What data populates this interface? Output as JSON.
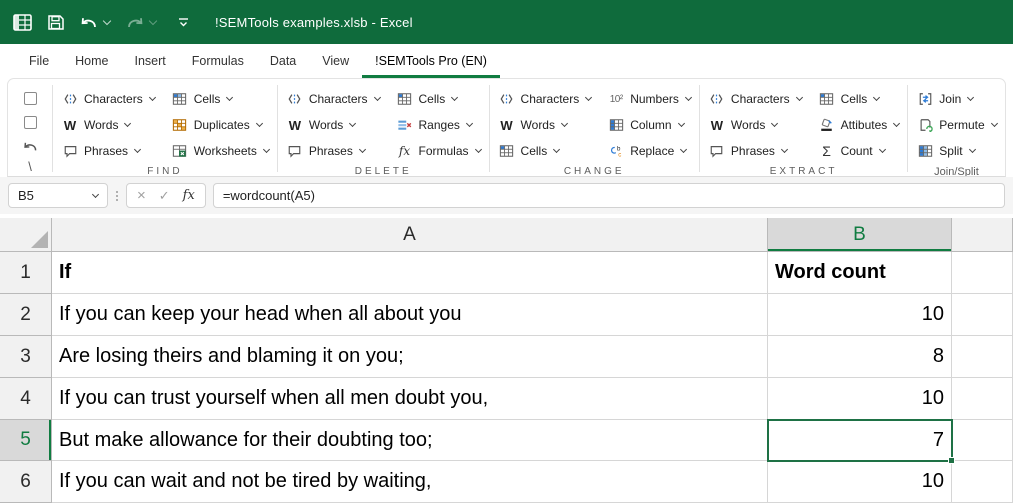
{
  "titlebar": {
    "title": "!SEMTools examples.xlsb  -  Excel",
    "icons": [
      "excel-logo-icon",
      "save-icon",
      "undo-icon",
      "redo-icon",
      "customize-quick-access-icon"
    ]
  },
  "tabs": {
    "items": [
      "File",
      "Home",
      "Insert",
      "Formulas",
      "Data",
      "View",
      "!SEMTools Pro (EN)"
    ],
    "active": "!SEMTools Pro (EN)"
  },
  "ribbon": {
    "quick_controls": {
      "checkboxes": 2,
      "undo_icon": "undo-icon",
      "backslash": "\\"
    },
    "groups": [
      {
        "label": "FIND",
        "items": [
          {
            "label": "Characters",
            "icon": "characters-icon"
          },
          {
            "label": "Words",
            "icon": "words-icon"
          },
          {
            "label": "Phrases",
            "icon": "phrases-icon"
          },
          {
            "label": "Cells",
            "icon": "cells-icon"
          },
          {
            "label": "Duplicates",
            "icon": "duplicates-icon"
          },
          {
            "label": "Worksheets",
            "icon": "worksheets-icon"
          }
        ]
      },
      {
        "label": "DELETE",
        "items": [
          {
            "label": "Characters",
            "icon": "characters-icon"
          },
          {
            "label": "Words",
            "icon": "words-icon"
          },
          {
            "label": "Phrases",
            "icon": "phrases-icon"
          },
          {
            "label": "Cells",
            "icon": "cells-icon"
          },
          {
            "label": "Ranges",
            "icon": "ranges-icon"
          },
          {
            "label": "Formulas",
            "icon": "formulas-icon"
          }
        ]
      },
      {
        "label": "CHANGE",
        "items": [
          {
            "label": "Characters",
            "icon": "characters-icon"
          },
          {
            "label": "Words",
            "icon": "words-icon"
          },
          {
            "label": "Cells",
            "icon": "cells-icon"
          },
          {
            "label": "Numbers",
            "icon": "numbers-icon"
          },
          {
            "label": "Column",
            "icon": "column-icon"
          },
          {
            "label": "Replace",
            "icon": "replace-icon"
          }
        ]
      },
      {
        "label": "EXTRACT",
        "items": [
          {
            "label": "Characters",
            "icon": "characters-icon"
          },
          {
            "label": "Words",
            "icon": "words-icon"
          },
          {
            "label": "Phrases",
            "icon": "phrases-icon"
          },
          {
            "label": "Cells",
            "icon": "cells-icon"
          },
          {
            "label": "Attibutes",
            "icon": "attributes-icon"
          },
          {
            "label": "Count",
            "icon": "count-icon"
          }
        ]
      },
      {
        "label": "Join/Split",
        "items": [
          {
            "label": "Join",
            "icon": "join-icon"
          },
          {
            "label": "Permute",
            "icon": "permute-icon"
          },
          {
            "label": "Split",
            "icon": "split-icon"
          }
        ]
      }
    ]
  },
  "formula_bar": {
    "cell_reference": "B5",
    "cancel_label": "×",
    "confirm_label": "✓",
    "fx_label": "fx",
    "formula": "=wordcount(A5)"
  },
  "sheet": {
    "selected_cell": "B5",
    "columns": [
      {
        "letter": "A"
      },
      {
        "letter": "B"
      }
    ],
    "rows": [
      {
        "num": "1",
        "a": "If",
        "b": "Word count"
      },
      {
        "num": "2",
        "a": "If you can keep your head when all about you",
        "b": "10"
      },
      {
        "num": "3",
        "a": "Are losing theirs and blaming it on you;",
        "b": "8"
      },
      {
        "num": "4",
        "a": "If you can trust yourself when all men doubt you,",
        "b": "10"
      },
      {
        "num": "5",
        "a": "But make allowance for their doubting too;",
        "b": "7"
      },
      {
        "num": "6",
        "a": "If you can wait and not be tired by waiting,",
        "b": "10"
      }
    ]
  },
  "colors": {
    "excel_green": "#107C41",
    "titlebar_green": "#0F6B3C",
    "selection_border": "#1E7145",
    "selected_header_bg": "#D9D9D9"
  }
}
